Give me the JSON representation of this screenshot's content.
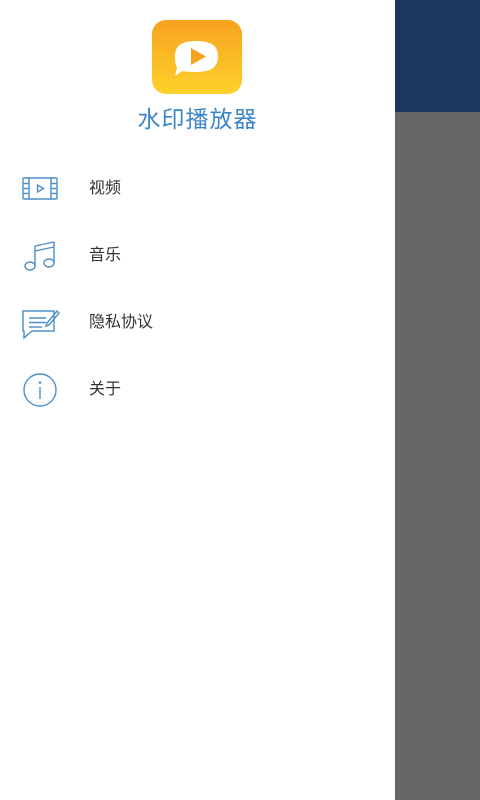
{
  "app": {
    "title": "水印播放器"
  },
  "menu": {
    "items": [
      {
        "label": "视频",
        "icon": "video-icon"
      },
      {
        "label": "音乐",
        "icon": "music-icon"
      },
      {
        "label": "隐私协议",
        "icon": "privacy-icon"
      },
      {
        "label": "关于",
        "icon": "info-icon"
      }
    ]
  },
  "colors": {
    "appbar": "#1b3760",
    "scrim": "#666666",
    "accent": "#3a86c8",
    "logo_top": "#f7a21f",
    "logo_bottom": "#fdd22b",
    "icon_stroke": "#4a8fc7",
    "text": "#333333"
  }
}
